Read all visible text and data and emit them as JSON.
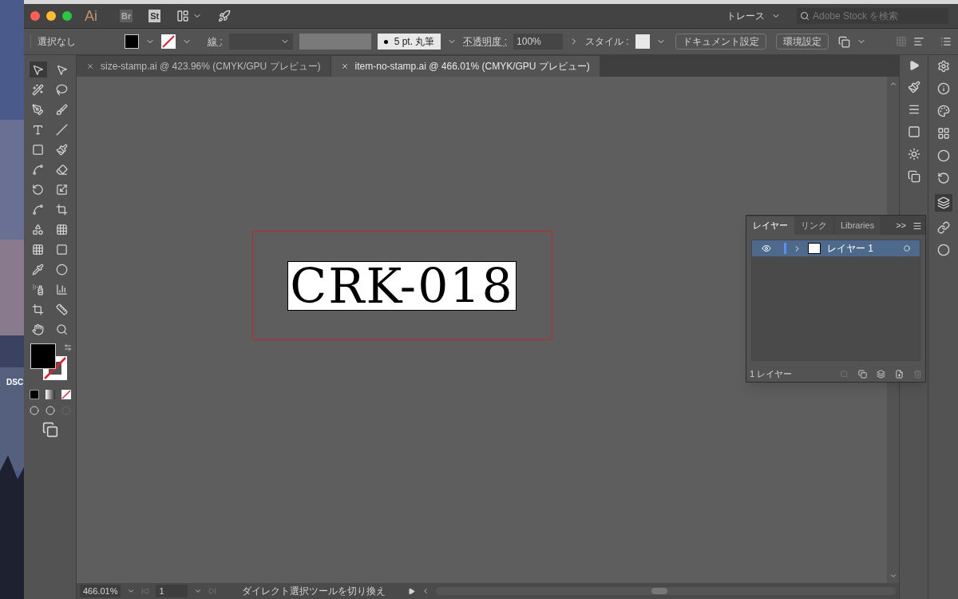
{
  "desktop": {
    "icon_label": "DSC"
  },
  "app_bar": {
    "app_icon": "Ai",
    "bridge": "Br",
    "stock": "St",
    "workspace": "トレース",
    "search": {
      "placeholder": "Adobe Stock を検索"
    }
  },
  "control_bar": {
    "selection": "選択なし",
    "stroke_label": "線 :",
    "brush": "5 pt. 丸筆",
    "opacity_label": "不透明度 :",
    "opacity": "100%",
    "style_label": "スタイル :",
    "buttons": [
      "ドキュメント設定",
      "環境設定"
    ]
  },
  "tabs": [
    {
      "label": "size-stamp.ai @ 423.96% (CMYK/GPU プレビュー)",
      "selected": false
    },
    {
      "label": "item-no-stamp.ai @ 466.01% (CMYK/GPU プレビュー)",
      "selected": true
    }
  ],
  "artboard": {
    "text": "CRK-018"
  },
  "layers_panel": {
    "tabs": [
      {
        "label": "レイヤー",
        "selected": true
      },
      {
        "label": "リンク",
        "selected": false
      },
      {
        "label": "Libraries",
        "selected": false
      }
    ],
    "more": ">>",
    "layers": [
      {
        "name": "レイヤー 1",
        "visible": true,
        "selected": true
      }
    ],
    "count": "1 レイヤー"
  },
  "status_bar": {
    "zoom": "466.01%",
    "artboard": "1",
    "message": "ダイレクト選択ツールを切り換え"
  }
}
